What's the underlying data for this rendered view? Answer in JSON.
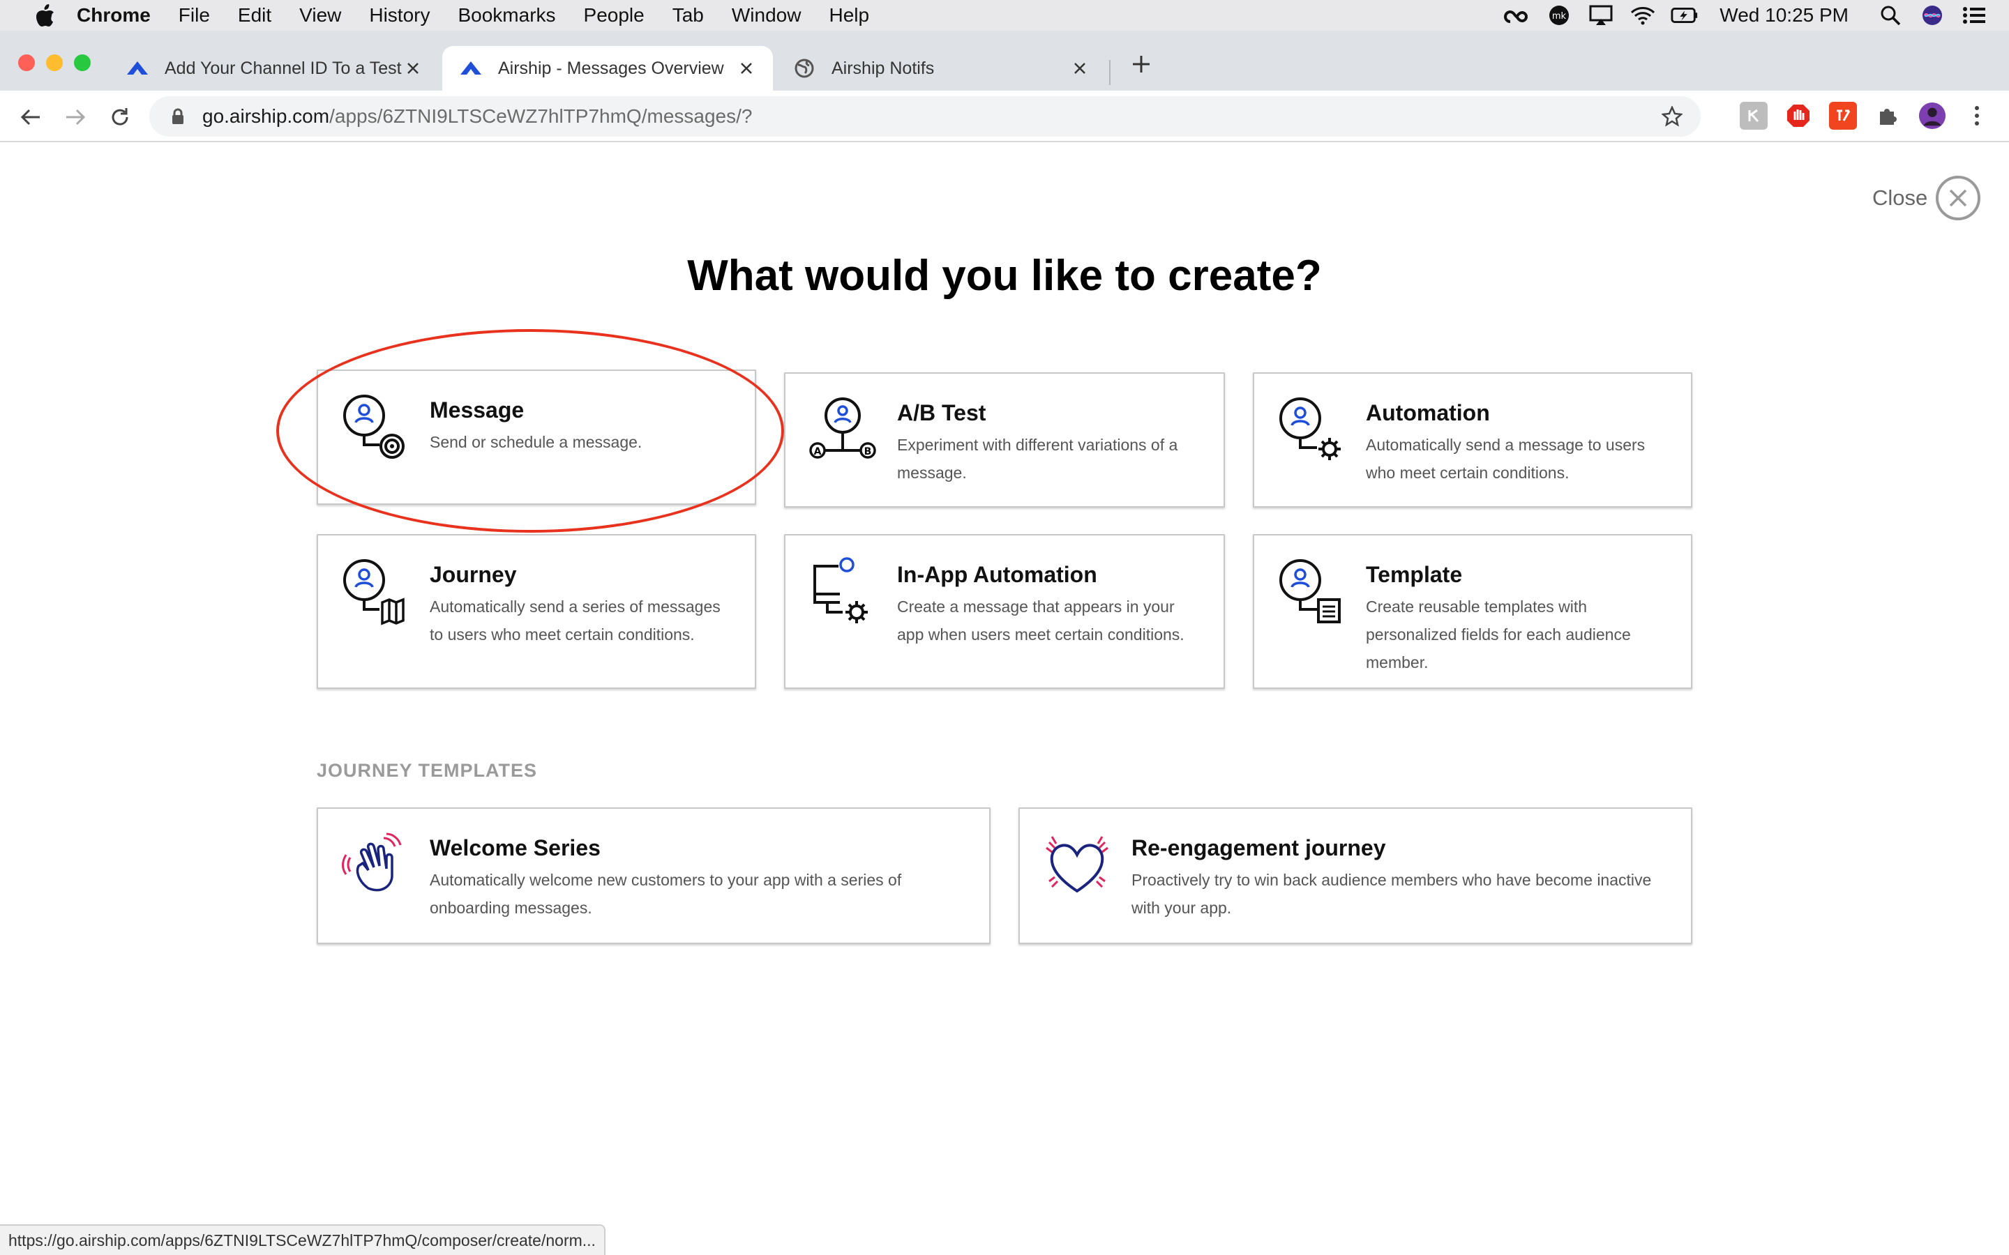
{
  "menubar": {
    "app_name": "Chrome",
    "items": [
      "File",
      "Edit",
      "View",
      "History",
      "Bookmarks",
      "People",
      "Tab",
      "Window",
      "Help"
    ],
    "clock": "Wed 10:25 PM",
    "status_icons": [
      "creative-cloud-icon",
      "mk-icon",
      "airplay-icon",
      "wifi-icon",
      "battery-icon",
      "spotlight-icon",
      "siri-icon",
      "control-center-icon"
    ]
  },
  "tabs": [
    {
      "title": "Add Your Channel ID To a Test",
      "favicon": "airship-icon",
      "active": false
    },
    {
      "title": "Airship - Messages Overview",
      "favicon": "airship-icon",
      "active": true
    },
    {
      "title": "Airship Notifs",
      "favicon": "globe-icon",
      "active": false
    }
  ],
  "toolbar": {
    "url_domain": "go.airship.com",
    "url_path": "/apps/6ZTNI9LTSCeWZ7hlTP7hmQ/messages/?"
  },
  "page": {
    "close_label": "Close",
    "headline": "What would you like to create?",
    "create_options": [
      {
        "title": "Message",
        "description": "Send or schedule a message.",
        "icon": "message-target-icon"
      },
      {
        "title": "A/B Test",
        "description": "Experiment with different variations of a message.",
        "icon": "ab-test-icon"
      },
      {
        "title": "Automation",
        "description": "Automatically send a message to users who meet certain conditions.",
        "icon": "automation-gear-icon"
      },
      {
        "title": "Journey",
        "description": "Automatically send a series of messages to users who meet certain conditions.",
        "icon": "journey-map-icon"
      },
      {
        "title": "In-App Automation",
        "description": "Create a message that appears in your app when users meet certain conditions.",
        "icon": "in-app-automation-icon"
      },
      {
        "title": "Template",
        "description": "Create reusable templates with personalized fields for each audience member.",
        "icon": "template-icon"
      }
    ],
    "journey_templates_label": "JOURNEY TEMPLATES",
    "journey_templates": [
      {
        "title": "Welcome Series",
        "description": "Automatically welcome new customers to your app with a series of onboarding messages.",
        "icon": "waving-hand-icon"
      },
      {
        "title": "Re-engagement journey",
        "description": "Proactively try to win back audience members who have become inactive with your app.",
        "icon": "heart-icon"
      }
    ]
  },
  "status_url": "https://go.airship.com/apps/6ZTNI9LTSCeWZ7hlTP7hmQ/composer/create/norm...",
  "colors": {
    "accent_blue": "#1f4ed8",
    "annotation_red": "#e8321e",
    "icon_pink": "#e0245e"
  }
}
